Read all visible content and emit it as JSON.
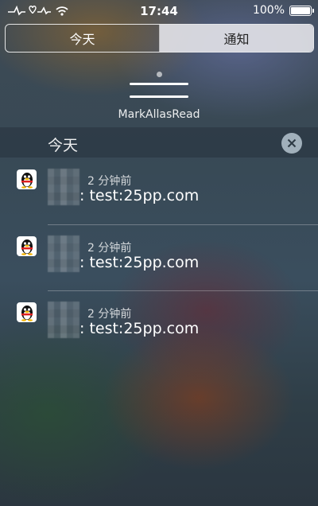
{
  "status_bar": {
    "time": "17:44",
    "battery_text": "100%",
    "battery_level": 1.0,
    "icons": [
      "heartbeat-icon",
      "wifi-icon",
      "battery-icon"
    ]
  },
  "tabs": [
    {
      "label": "今天",
      "active": false
    },
    {
      "label": "通知",
      "active": true
    }
  ],
  "handle": {
    "label": "MarkAllasRead"
  },
  "section": {
    "title": "今天",
    "clear_icon": "close-icon"
  },
  "notifications": [
    {
      "app_icon": "qq-penguin-icon",
      "time": "2 分钟前",
      "body": ": test:25pp.com"
    },
    {
      "app_icon": "qq-penguin-icon",
      "time": "2 分钟前",
      "body": ": test:25pp.com"
    },
    {
      "app_icon": "qq-penguin-icon",
      "time": "2 分钟前",
      "body": ": test:25pp.com"
    }
  ],
  "colors": {
    "active_tab_bg": "#e1e1e6",
    "clear_button_bg": "#c8d7e1"
  }
}
